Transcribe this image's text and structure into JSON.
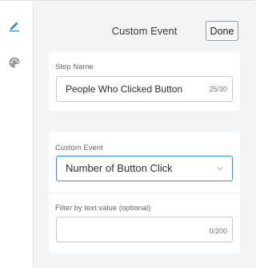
{
  "rail": {
    "items": [
      {
        "icon": "pencil-icon",
        "active": true
      },
      {
        "icon": "palette-icon",
        "active": false
      }
    ]
  },
  "header": {
    "title": "Custom Event",
    "done_label": "Done"
  },
  "step_name": {
    "label": "Step Name",
    "value": "People Who Clicked Button",
    "counter": "25/30"
  },
  "custom_event": {
    "label": "Custom Event",
    "selected": "Number of Button Click"
  },
  "filter": {
    "label": "Filter by text value (optional)",
    "value": "",
    "counter": "0/200"
  },
  "colors": {
    "accent": "#2d8cf0",
    "rail_inactive": "#9a9a9a"
  }
}
